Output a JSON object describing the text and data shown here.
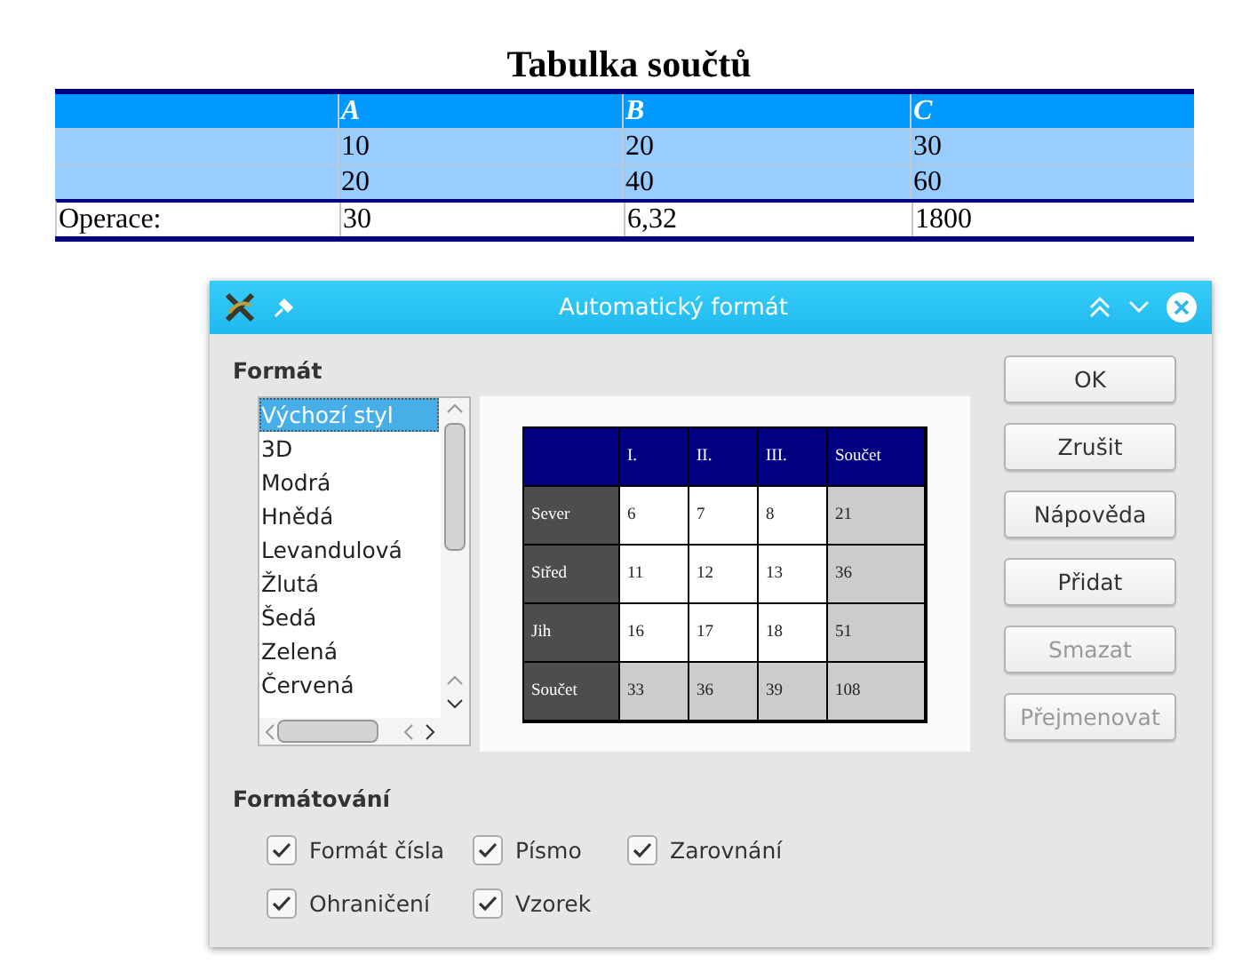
{
  "document": {
    "title": "Tabulka součtů",
    "table": {
      "columns": [
        "A",
        "B",
        "C"
      ],
      "rows": [
        {
          "kind": "value",
          "cells": [
            "10",
            "20",
            "30"
          ]
        },
        {
          "kind": "value",
          "cells": [
            "20",
            "40",
            "60"
          ]
        },
        {
          "kind": "result",
          "label": "Operace:",
          "cells": [
            "30",
            "6,32",
            "1800"
          ]
        }
      ]
    }
  },
  "dialog": {
    "title": "Automatický formát",
    "format_heading": "Formát",
    "styles": [
      {
        "label": "Výchozí styl",
        "selected": true
      },
      {
        "label": "3D",
        "selected": false
      },
      {
        "label": "Modrá",
        "selected": false
      },
      {
        "label": "Hnědá",
        "selected": false
      },
      {
        "label": "Levandulová",
        "selected": false
      },
      {
        "label": "Žlutá",
        "selected": false
      },
      {
        "label": "Šedá",
        "selected": false
      },
      {
        "label": "Zelená",
        "selected": false
      },
      {
        "label": "Červená",
        "selected": false
      }
    ],
    "preview": {
      "columns": [
        "I.",
        "II.",
        "III.",
        "Součet"
      ],
      "rows": [
        {
          "kind": "data",
          "label": "Sever",
          "cells": [
            "6",
            "7",
            "8",
            "21"
          ]
        },
        {
          "kind": "data",
          "label": "Střed",
          "cells": [
            "11",
            "12",
            "13",
            "36"
          ]
        },
        {
          "kind": "data",
          "label": "Jih",
          "cells": [
            "16",
            "17",
            "18",
            "51"
          ]
        },
        {
          "kind": "total",
          "label": "Součet",
          "cells": [
            "33",
            "36",
            "39",
            "108"
          ]
        }
      ]
    },
    "buttons": [
      {
        "label": "OK",
        "disabled": false
      },
      {
        "label": "Zrušit",
        "disabled": false
      },
      {
        "label": "Nápověda",
        "disabled": false
      },
      {
        "label": "Přidat",
        "disabled": false
      },
      {
        "label": "Smazat",
        "disabled": true
      },
      {
        "label": "Přejmenovat",
        "disabled": true
      }
    ],
    "formatting_heading": "Formátování",
    "options": [
      {
        "label": "Formát čísla",
        "checked": true
      },
      {
        "label": "Písmo",
        "checked": true
      },
      {
        "label": "Zarovnání",
        "checked": true
      },
      {
        "label": "Ohraničení",
        "checked": true
      },
      {
        "label": "Vzorek",
        "checked": true
      }
    ]
  }
}
